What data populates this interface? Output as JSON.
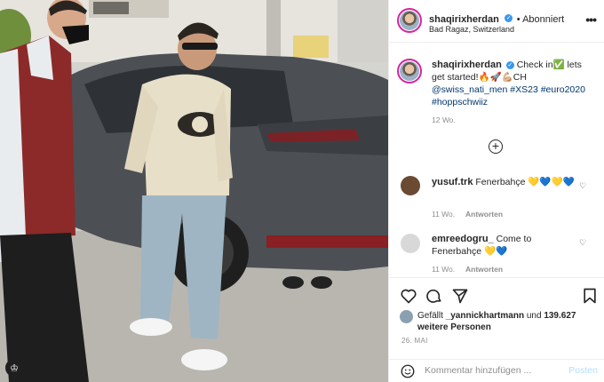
{
  "post": {
    "username": "shaqirixherdan",
    "verified_mark": "✓",
    "follow_state": "Abonniert",
    "location": "Bad Ragaz, Switzerland",
    "more_icon": "more-icon",
    "photo_logo_glyph": "♔",
    "caption": {
      "text": "Check in✅ lets get started!🔥🚀💪🏼CH",
      "tags": "@swiss_nati_men #XS23 #euro2020 #hoppschwiiz",
      "time": "12 Wo."
    },
    "load_more_glyph": "+",
    "comments": [
      {
        "username": "yusuf.trk",
        "text": "Fenerbahçe 💛💙💛💙",
        "time": "11 Wo.",
        "reply_label": "Antworten"
      },
      {
        "username": "emreedogru_",
        "text": "Come to Fenerbahçe 💛💙",
        "time": "11 Wo.",
        "reply_label": "Antworten"
      }
    ],
    "likes": {
      "prefix": "Gefällt ",
      "user": "_yannickhartmann",
      "middle": " und ",
      "count": "139.627 weitere Personen"
    },
    "date": "26. MAI",
    "comment_placeholder": "Kommentar hinzufügen ...",
    "post_label": "Posten"
  }
}
